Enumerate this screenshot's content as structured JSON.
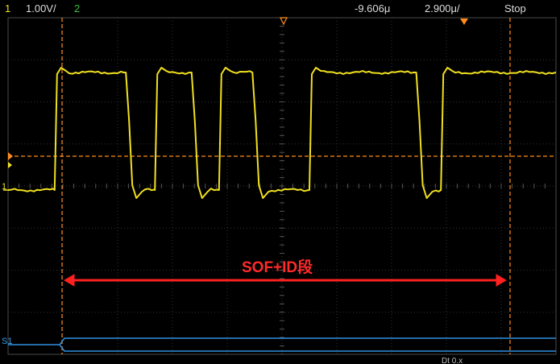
{
  "status_bar": {
    "ch1_number": "1",
    "ch1_scale": "1.00V/",
    "ch2_number": "2",
    "time_offset": "-9.606μ",
    "time_scale": "2.900μ/",
    "run_state": "Stop"
  },
  "annotation": {
    "segment_label": "SOF+ID段"
  },
  "markers": {
    "serial_label": "S1",
    "ch1_ground_label": "1",
    "footer_partial": "Dt  0.x"
  },
  "colors": {
    "signal": "#f0e020",
    "cursor": "#ff8c1a",
    "grid": "#3a3a3a",
    "arrow": "#ff2020",
    "serial": "#2f8fe0"
  },
  "waveform": {
    "high_level": 1,
    "low_level": 0,
    "edges": [
      {
        "type": "rise",
        "at_div": 0.85
      },
      {
        "type": "fall",
        "at_div": 2.15
      },
      {
        "type": "rise",
        "at_div": 2.68
      },
      {
        "type": "fall",
        "at_div": 3.35
      },
      {
        "type": "rise",
        "at_div": 3.85
      },
      {
        "type": "fall",
        "at_div": 4.46
      },
      {
        "type": "rise",
        "at_div": 5.5
      },
      {
        "type": "fall",
        "at_div": 7.45
      },
      {
        "type": "rise",
        "at_div": 7.9
      }
    ]
  }
}
